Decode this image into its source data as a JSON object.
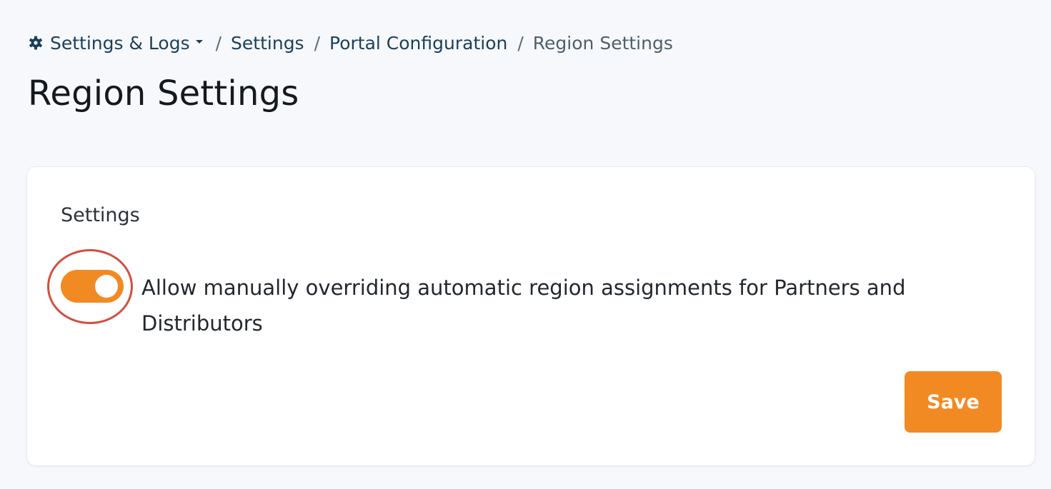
{
  "breadcrumb": {
    "root_label": "Settings & Logs",
    "root_icon": "gear-icon",
    "items": [
      {
        "label": "Settings"
      },
      {
        "label": "Portal Configuration"
      },
      {
        "label": "Region Settings"
      }
    ],
    "separator": "/"
  },
  "page": {
    "title": "Region Settings"
  },
  "card": {
    "section_title": "Settings",
    "toggle": {
      "state": "on",
      "label": "Allow manually overriding automatic region assignments for Partners and Distributors"
    },
    "save_label": "Save"
  },
  "colors": {
    "accent": "#f28a23",
    "link": "#1b3f5c",
    "highlight_ring": "#d14f3f",
    "background": "#f6f8fb",
    "card": "#ffffff"
  }
}
